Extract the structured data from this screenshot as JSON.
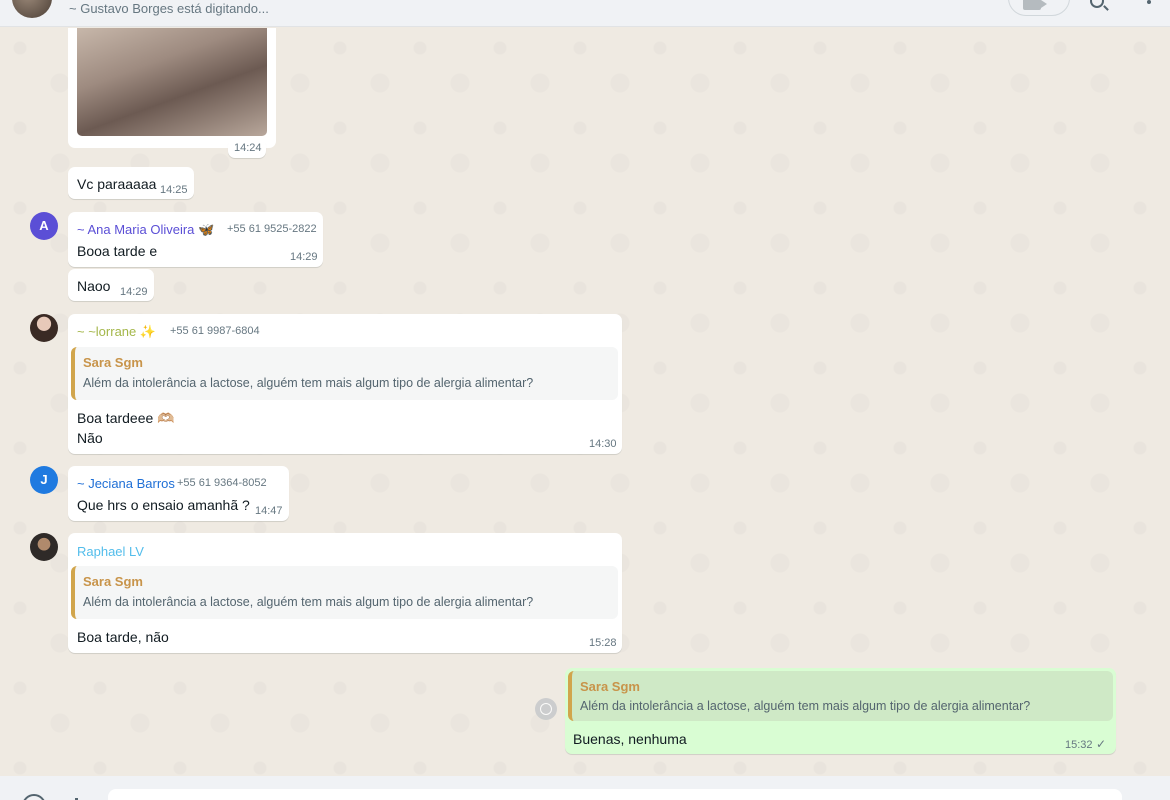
{
  "header": {
    "typing_status": "~ Gustavo Borges está digitando..."
  },
  "messages": [
    {
      "id": "m0",
      "type": "image",
      "time": "14:24"
    },
    {
      "id": "m1",
      "text": "Vc paraaaaa",
      "time": "14:25"
    },
    {
      "id": "m2",
      "sender": "~ Ana Maria Oliveira",
      "sender_emoji": "🦋",
      "phone": "+55 61 9525-2822",
      "avatar_letter": "A",
      "text": "Booa tarde e",
      "time": "14:29"
    },
    {
      "id": "m3",
      "text": "Naoo",
      "time": "14:29"
    },
    {
      "id": "m4",
      "sender": "~ ~lorrane",
      "sender_emoji": "✨",
      "phone": "+55 61 9987-6804",
      "quote": {
        "name": "Sara Sgm",
        "text": "Além da intolerância a lactose, alguém tem mais algum tipo de alergia alimentar?"
      },
      "lines": [
        "Boa tardeee 🫶🏼",
        "Não"
      ],
      "time": "14:30"
    },
    {
      "id": "m5",
      "sender": "~ Jeciana Barros",
      "phone": "+55 61 9364-8052",
      "avatar_letter": "J",
      "text": "Que hrs o ensaio amanhã ?",
      "time": "14:47"
    },
    {
      "id": "m6",
      "sender": "Raphael LV",
      "quote": {
        "name": "Sara Sgm",
        "text": "Além da intolerância a lactose, alguém tem mais algum tipo de alergia alimentar?"
      },
      "text": "Boa tarde, não",
      "time": "15:28"
    },
    {
      "id": "m7",
      "outgoing": true,
      "quote": {
        "name": "Sara Sgm",
        "text": "Além da intolerância a lactose, alguém tem mais algum tipo de alergia alimentar?"
      },
      "text": "Buenas, nenhuma",
      "time": "15:32",
      "status_icon": "check-icon"
    }
  ],
  "colors": {
    "ana_name": "#5b4fd6",
    "lorrane_name": "#a4b74a",
    "jeciana_name": "#1f6fd6",
    "raphael_name": "#53bdeb",
    "quote_name": "#c8944a",
    "outgoing_bubble": "#d9fdd3"
  }
}
